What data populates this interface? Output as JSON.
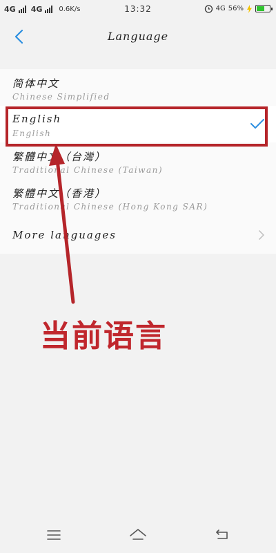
{
  "status_bar": {
    "network_1": "4G",
    "network_2": "4G",
    "speed": "0.6K/s",
    "time": "13:32",
    "network_volte": "4G",
    "battery": "56%"
  },
  "header": {
    "title": "Language",
    "back_icon": "back-arrow-icon"
  },
  "languages": [
    {
      "primary": "简体中文",
      "secondary": "Chinese Simplified",
      "selected": false
    },
    {
      "primary": "English",
      "secondary": "English",
      "selected": true
    },
    {
      "primary": "繁體中文（台灣）",
      "secondary": "Traditional Chinese (Taiwan)",
      "selected": false
    },
    {
      "primary": "繁體中文（香港）",
      "secondary": "Traditional Chinese (Hong Kong SAR)",
      "selected": false
    }
  ],
  "more_languages": "More languages",
  "annotation": {
    "label": "当前语言",
    "color": "#c0272d"
  },
  "colors": {
    "accent": "#2d8fe0",
    "highlight": "#b5252a"
  },
  "nav_bar": {
    "menu_icon": "menu-icon",
    "home_icon": "home-icon",
    "back_icon": "back-icon"
  }
}
